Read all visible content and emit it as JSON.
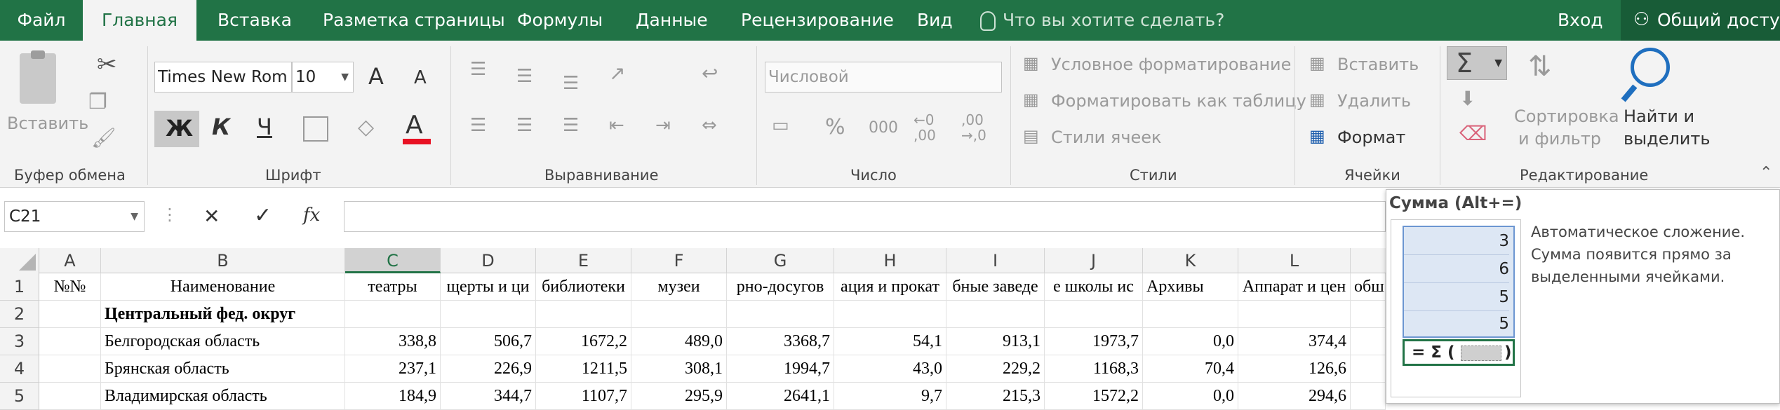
{
  "tabs": [
    "Файл",
    "Главная",
    "Вставка",
    "Разметка страницы",
    "Формулы",
    "Данные",
    "Рецензирование",
    "Вид"
  ],
  "tell_me": "Что вы хотите сделать?",
  "sign_in": "Вход",
  "share": "Общий доступ",
  "clipboard": {
    "paste": "Вставить",
    "group": "Буфер обмена"
  },
  "font": {
    "name": "Times New Rom",
    "size": "10",
    "group": "Шрифт",
    "bold": "Ж",
    "italic": "К",
    "underline": "Ч"
  },
  "alignment": {
    "group": "Выравнивание"
  },
  "number": {
    "format": "Числовой",
    "group": "Число",
    "percent": "%",
    "thousands": "000",
    "inc": "←0\n,00",
    "dec": ",00\n→,0"
  },
  "styles": {
    "conditional": "Условное форматирование",
    "table": "Форматировать как таблицу",
    "cell_styles": "Стили ячеек",
    "group": "Стили"
  },
  "cells": {
    "insert": "Вставить",
    "delete": "Удалить",
    "format": "Формат",
    "group": "Ячейки"
  },
  "editing": {
    "sort_l1": "Сортировка",
    "sort_l2": "и фильтр",
    "find_l1": "Найти и",
    "find_l2": "выделить",
    "group": "Редактирование",
    "sigma": "Σ"
  },
  "name_box": "C21",
  "fx": "fx",
  "columns": [
    "A",
    "B",
    "C",
    "D",
    "E",
    "F",
    "G",
    "H",
    "I",
    "J",
    "K",
    "L"
  ],
  "rows": [
    {
      "num": "1",
      "cells": [
        "№№",
        "Наименование",
        "театры",
        "щерты и ци",
        "библиотеки",
        "музеи",
        "рно-досугов",
        "ация и прокат",
        "бные заведе",
        "е школы ис",
        "Архивы",
        "Аппарат и цен",
        "обш"
      ]
    },
    {
      "num": "2",
      "cells": [
        "",
        "Центральный фед. округ",
        "",
        "",
        "",
        "",
        "",
        "",
        "",
        "",
        "",
        "",
        ""
      ]
    },
    {
      "num": "3",
      "cells": [
        "",
        "Белгородская область",
        "338,8",
        "506,7",
        "1672,2",
        "489,0",
        "3368,7",
        "54,1",
        "913,1",
        "1973,7",
        "0,0",
        "374,4",
        ""
      ]
    },
    {
      "num": "4",
      "cells": [
        "",
        "Брянская область",
        "237,1",
        "226,9",
        "1211,5",
        "308,1",
        "1994,7",
        "43,0",
        "229,2",
        "1168,3",
        "70,4",
        "126,6",
        ""
      ]
    },
    {
      "num": "5",
      "cells": [
        "",
        "Владимирская область",
        "184,9",
        "344,7",
        "1107,7",
        "295,9",
        "2641,1",
        "9,7",
        "215,3",
        "1572,2",
        "0,0",
        "294,6",
        ""
      ]
    }
  ],
  "tooltip": {
    "title": "Сумма (Alt+=)",
    "description": "Автоматическое сложение. Сумма появится прямо за выделенными ячейками.",
    "preview_values": [
      "3",
      "6",
      "5",
      "5"
    ],
    "preview_formula": "= Σ ("
  },
  "colors": {
    "accent": "#217346",
    "ribbon": "#f3f3f3",
    "red": "#e81123"
  }
}
